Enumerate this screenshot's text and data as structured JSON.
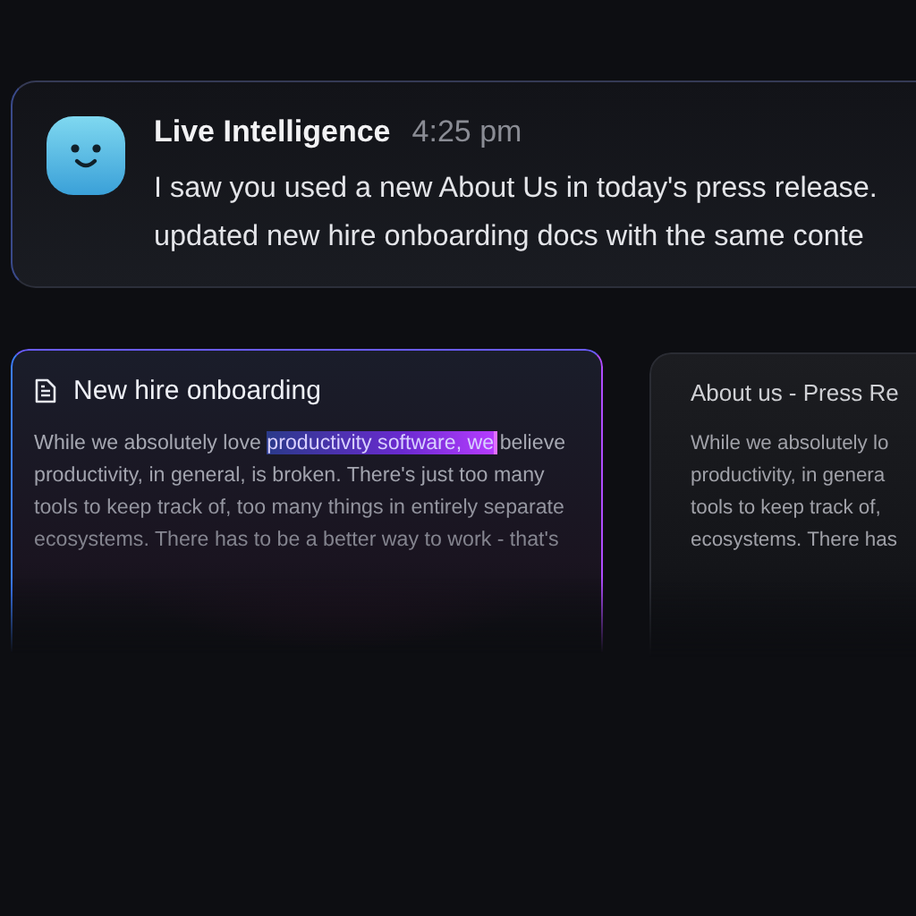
{
  "message": {
    "sender": "Live Intelligence",
    "time": "4:25 pm",
    "lines": [
      "I saw you used a new About Us in today's press release.",
      "updated new hire onboarding docs with the same conte"
    ]
  },
  "documents": [
    {
      "title": "New hire onboarding",
      "selected": true,
      "text_before": "While we absolutely love ",
      "selected_text": "productivity software, we",
      "text_after": " believe productivity, in general, is broken. There's just too many tools to keep track of, too many things in entirely separate ecosystems. There has to be a better way to work - that's"
    },
    {
      "title": "About us - Press Re",
      "selected": false,
      "lines": [
        "While we absolutely lo",
        "productivity, in genera",
        "tools to keep track of,",
        "ecosystems. There has"
      ]
    }
  ]
}
